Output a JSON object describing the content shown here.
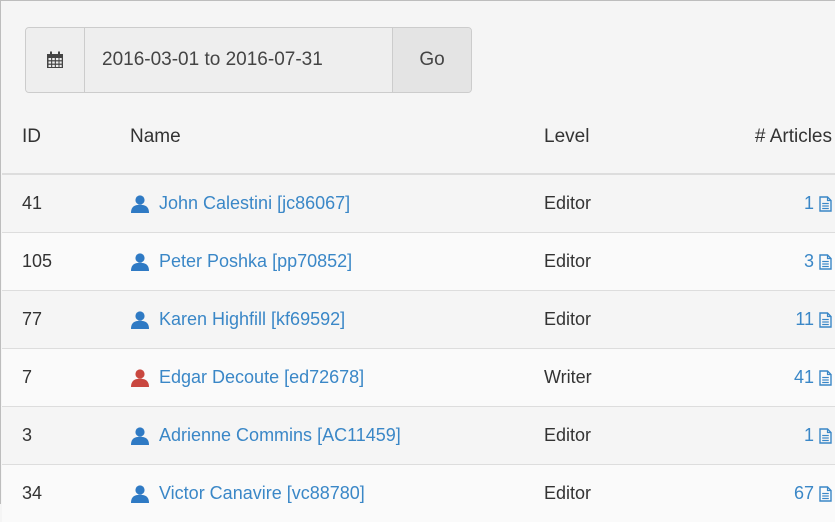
{
  "colors": {
    "link": "#3a87c7",
    "user_default": "#2f7ac4",
    "user_alert": "#c9473f"
  },
  "filter": {
    "calendar_icon": "calendar-icon",
    "date_range": "2016-03-01 to 2016-07-31",
    "go_label": "Go"
  },
  "table": {
    "headers": {
      "id": "ID",
      "name": "Name",
      "level": "Level",
      "articles": "# Articles"
    },
    "rows": [
      {
        "id": "41",
        "name": "John Calestini [jc86067]",
        "level": "Editor",
        "articles": "1",
        "user_color": "#2f7ac4"
      },
      {
        "id": "105",
        "name": "Peter Poshka [pp70852]",
        "level": "Editor",
        "articles": "3",
        "user_color": "#2f7ac4"
      },
      {
        "id": "77",
        "name": "Karen Highfill [kf69592]",
        "level": "Editor",
        "articles": "11",
        "user_color": "#2f7ac4"
      },
      {
        "id": "7",
        "name": "Edgar Decoute [ed72678]",
        "level": "Writer",
        "articles": "41",
        "user_color": "#c9473f"
      },
      {
        "id": "3",
        "name": "Adrienne Commins [AC11459]",
        "level": "Editor",
        "articles": "1",
        "user_color": "#2f7ac4"
      },
      {
        "id": "34",
        "name": "Victor Canavire [vc88780]",
        "level": "Editor",
        "articles": "67",
        "user_color": "#2f7ac4"
      }
    ]
  }
}
